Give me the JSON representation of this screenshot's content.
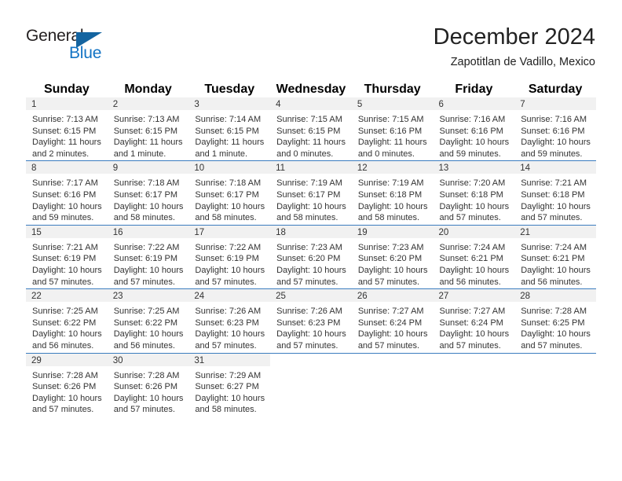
{
  "brand": {
    "name_part1": "General",
    "name_part2": "Blue",
    "triangle_icon": "triangle-icon",
    "colors": {
      "dark": "#231f20",
      "blue": "#1273c4",
      "header_blue": "#3b7dbf",
      "cell_gray": "#f1f1f1"
    }
  },
  "header": {
    "title": "December 2024",
    "subtitle": "Zapotitlan de Vadillo, Mexico"
  },
  "calendar": {
    "weekday_headers": [
      "Sunday",
      "Monday",
      "Tuesday",
      "Wednesday",
      "Thursday",
      "Friday",
      "Saturday"
    ],
    "weeks": [
      [
        {
          "day": "1",
          "sunrise": "Sunrise: 7:13 AM",
          "sunset": "Sunset: 6:15 PM",
          "daylight_line1": "Daylight: 11 hours",
          "daylight_line2": "and 2 minutes."
        },
        {
          "day": "2",
          "sunrise": "Sunrise: 7:13 AM",
          "sunset": "Sunset: 6:15 PM",
          "daylight_line1": "Daylight: 11 hours",
          "daylight_line2": "and 1 minute."
        },
        {
          "day": "3",
          "sunrise": "Sunrise: 7:14 AM",
          "sunset": "Sunset: 6:15 PM",
          "daylight_line1": "Daylight: 11 hours",
          "daylight_line2": "and 1 minute."
        },
        {
          "day": "4",
          "sunrise": "Sunrise: 7:15 AM",
          "sunset": "Sunset: 6:15 PM",
          "daylight_line1": "Daylight: 11 hours",
          "daylight_line2": "and 0 minutes."
        },
        {
          "day": "5",
          "sunrise": "Sunrise: 7:15 AM",
          "sunset": "Sunset: 6:16 PM",
          "daylight_line1": "Daylight: 11 hours",
          "daylight_line2": "and 0 minutes."
        },
        {
          "day": "6",
          "sunrise": "Sunrise: 7:16 AM",
          "sunset": "Sunset: 6:16 PM",
          "daylight_line1": "Daylight: 10 hours",
          "daylight_line2": "and 59 minutes."
        },
        {
          "day": "7",
          "sunrise": "Sunrise: 7:16 AM",
          "sunset": "Sunset: 6:16 PM",
          "daylight_line1": "Daylight: 10 hours",
          "daylight_line2": "and 59 minutes."
        }
      ],
      [
        {
          "day": "8",
          "sunrise": "Sunrise: 7:17 AM",
          "sunset": "Sunset: 6:16 PM",
          "daylight_line1": "Daylight: 10 hours",
          "daylight_line2": "and 59 minutes."
        },
        {
          "day": "9",
          "sunrise": "Sunrise: 7:18 AM",
          "sunset": "Sunset: 6:17 PM",
          "daylight_line1": "Daylight: 10 hours",
          "daylight_line2": "and 58 minutes."
        },
        {
          "day": "10",
          "sunrise": "Sunrise: 7:18 AM",
          "sunset": "Sunset: 6:17 PM",
          "daylight_line1": "Daylight: 10 hours",
          "daylight_line2": "and 58 minutes."
        },
        {
          "day": "11",
          "sunrise": "Sunrise: 7:19 AM",
          "sunset": "Sunset: 6:17 PM",
          "daylight_line1": "Daylight: 10 hours",
          "daylight_line2": "and 58 minutes."
        },
        {
          "day": "12",
          "sunrise": "Sunrise: 7:19 AM",
          "sunset": "Sunset: 6:18 PM",
          "daylight_line1": "Daylight: 10 hours",
          "daylight_line2": "and 58 minutes."
        },
        {
          "day": "13",
          "sunrise": "Sunrise: 7:20 AM",
          "sunset": "Sunset: 6:18 PM",
          "daylight_line1": "Daylight: 10 hours",
          "daylight_line2": "and 57 minutes."
        },
        {
          "day": "14",
          "sunrise": "Sunrise: 7:21 AM",
          "sunset": "Sunset: 6:18 PM",
          "daylight_line1": "Daylight: 10 hours",
          "daylight_line2": "and 57 minutes."
        }
      ],
      [
        {
          "day": "15",
          "sunrise": "Sunrise: 7:21 AM",
          "sunset": "Sunset: 6:19 PM",
          "daylight_line1": "Daylight: 10 hours",
          "daylight_line2": "and 57 minutes."
        },
        {
          "day": "16",
          "sunrise": "Sunrise: 7:22 AM",
          "sunset": "Sunset: 6:19 PM",
          "daylight_line1": "Daylight: 10 hours",
          "daylight_line2": "and 57 minutes."
        },
        {
          "day": "17",
          "sunrise": "Sunrise: 7:22 AM",
          "sunset": "Sunset: 6:19 PM",
          "daylight_line1": "Daylight: 10 hours",
          "daylight_line2": "and 57 minutes."
        },
        {
          "day": "18",
          "sunrise": "Sunrise: 7:23 AM",
          "sunset": "Sunset: 6:20 PM",
          "daylight_line1": "Daylight: 10 hours",
          "daylight_line2": "and 57 minutes."
        },
        {
          "day": "19",
          "sunrise": "Sunrise: 7:23 AM",
          "sunset": "Sunset: 6:20 PM",
          "daylight_line1": "Daylight: 10 hours",
          "daylight_line2": "and 57 minutes."
        },
        {
          "day": "20",
          "sunrise": "Sunrise: 7:24 AM",
          "sunset": "Sunset: 6:21 PM",
          "daylight_line1": "Daylight: 10 hours",
          "daylight_line2": "and 56 minutes."
        },
        {
          "day": "21",
          "sunrise": "Sunrise: 7:24 AM",
          "sunset": "Sunset: 6:21 PM",
          "daylight_line1": "Daylight: 10 hours",
          "daylight_line2": "and 56 minutes."
        }
      ],
      [
        {
          "day": "22",
          "sunrise": "Sunrise: 7:25 AM",
          "sunset": "Sunset: 6:22 PM",
          "daylight_line1": "Daylight: 10 hours",
          "daylight_line2": "and 56 minutes."
        },
        {
          "day": "23",
          "sunrise": "Sunrise: 7:25 AM",
          "sunset": "Sunset: 6:22 PM",
          "daylight_line1": "Daylight: 10 hours",
          "daylight_line2": "and 56 minutes."
        },
        {
          "day": "24",
          "sunrise": "Sunrise: 7:26 AM",
          "sunset": "Sunset: 6:23 PM",
          "daylight_line1": "Daylight: 10 hours",
          "daylight_line2": "and 57 minutes."
        },
        {
          "day": "25",
          "sunrise": "Sunrise: 7:26 AM",
          "sunset": "Sunset: 6:23 PM",
          "daylight_line1": "Daylight: 10 hours",
          "daylight_line2": "and 57 minutes."
        },
        {
          "day": "26",
          "sunrise": "Sunrise: 7:27 AM",
          "sunset": "Sunset: 6:24 PM",
          "daylight_line1": "Daylight: 10 hours",
          "daylight_line2": "and 57 minutes."
        },
        {
          "day": "27",
          "sunrise": "Sunrise: 7:27 AM",
          "sunset": "Sunset: 6:24 PM",
          "daylight_line1": "Daylight: 10 hours",
          "daylight_line2": "and 57 minutes."
        },
        {
          "day": "28",
          "sunrise": "Sunrise: 7:28 AM",
          "sunset": "Sunset: 6:25 PM",
          "daylight_line1": "Daylight: 10 hours",
          "daylight_line2": "and 57 minutes."
        }
      ],
      [
        {
          "day": "29",
          "sunrise": "Sunrise: 7:28 AM",
          "sunset": "Sunset: 6:26 PM",
          "daylight_line1": "Daylight: 10 hours",
          "daylight_line2": "and 57 minutes."
        },
        {
          "day": "30",
          "sunrise": "Sunrise: 7:28 AM",
          "sunset": "Sunset: 6:26 PM",
          "daylight_line1": "Daylight: 10 hours",
          "daylight_line2": "and 57 minutes."
        },
        {
          "day": "31",
          "sunrise": "Sunrise: 7:29 AM",
          "sunset": "Sunset: 6:27 PM",
          "daylight_line1": "Daylight: 10 hours",
          "daylight_line2": "and 58 minutes."
        },
        null,
        null,
        null,
        null
      ]
    ]
  }
}
